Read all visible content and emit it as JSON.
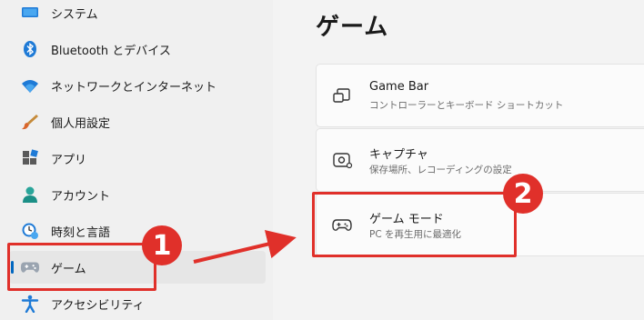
{
  "sidebar": {
    "items": [
      {
        "label": "システム",
        "icon": "system-icon"
      },
      {
        "label": "Bluetooth とデバイス",
        "icon": "bluetooth-icon"
      },
      {
        "label": "ネットワークとインターネット",
        "icon": "wifi-icon"
      },
      {
        "label": "個人用設定",
        "icon": "brush-icon"
      },
      {
        "label": "アプリ",
        "icon": "apps-icon"
      },
      {
        "label": "アカウント",
        "icon": "account-icon"
      },
      {
        "label": "時刻と言語",
        "icon": "clock-globe-icon"
      },
      {
        "label": "ゲーム",
        "icon": "gamepad-icon",
        "selected": true
      },
      {
        "label": "アクセシビリティ",
        "icon": "accessibility-icon"
      }
    ]
  },
  "main": {
    "title": "ゲーム",
    "cards": [
      {
        "title": "Game Bar",
        "subtitle": "コントローラーとキーボード ショートカット",
        "icon": "game-bar-icon"
      },
      {
        "title": "キャプチャ",
        "subtitle": "保存場所、レコーディングの設定",
        "icon": "capture-icon"
      },
      {
        "title": "ゲーム モード",
        "subtitle": "PC を再生用に最適化",
        "icon": "gamepad-icon"
      }
    ]
  },
  "annotations": {
    "step1": "1",
    "step2": "2",
    "color": "#e0302a"
  },
  "colors": {
    "accent": "#0067c0",
    "selected_bg": "#e6e6e6"
  }
}
